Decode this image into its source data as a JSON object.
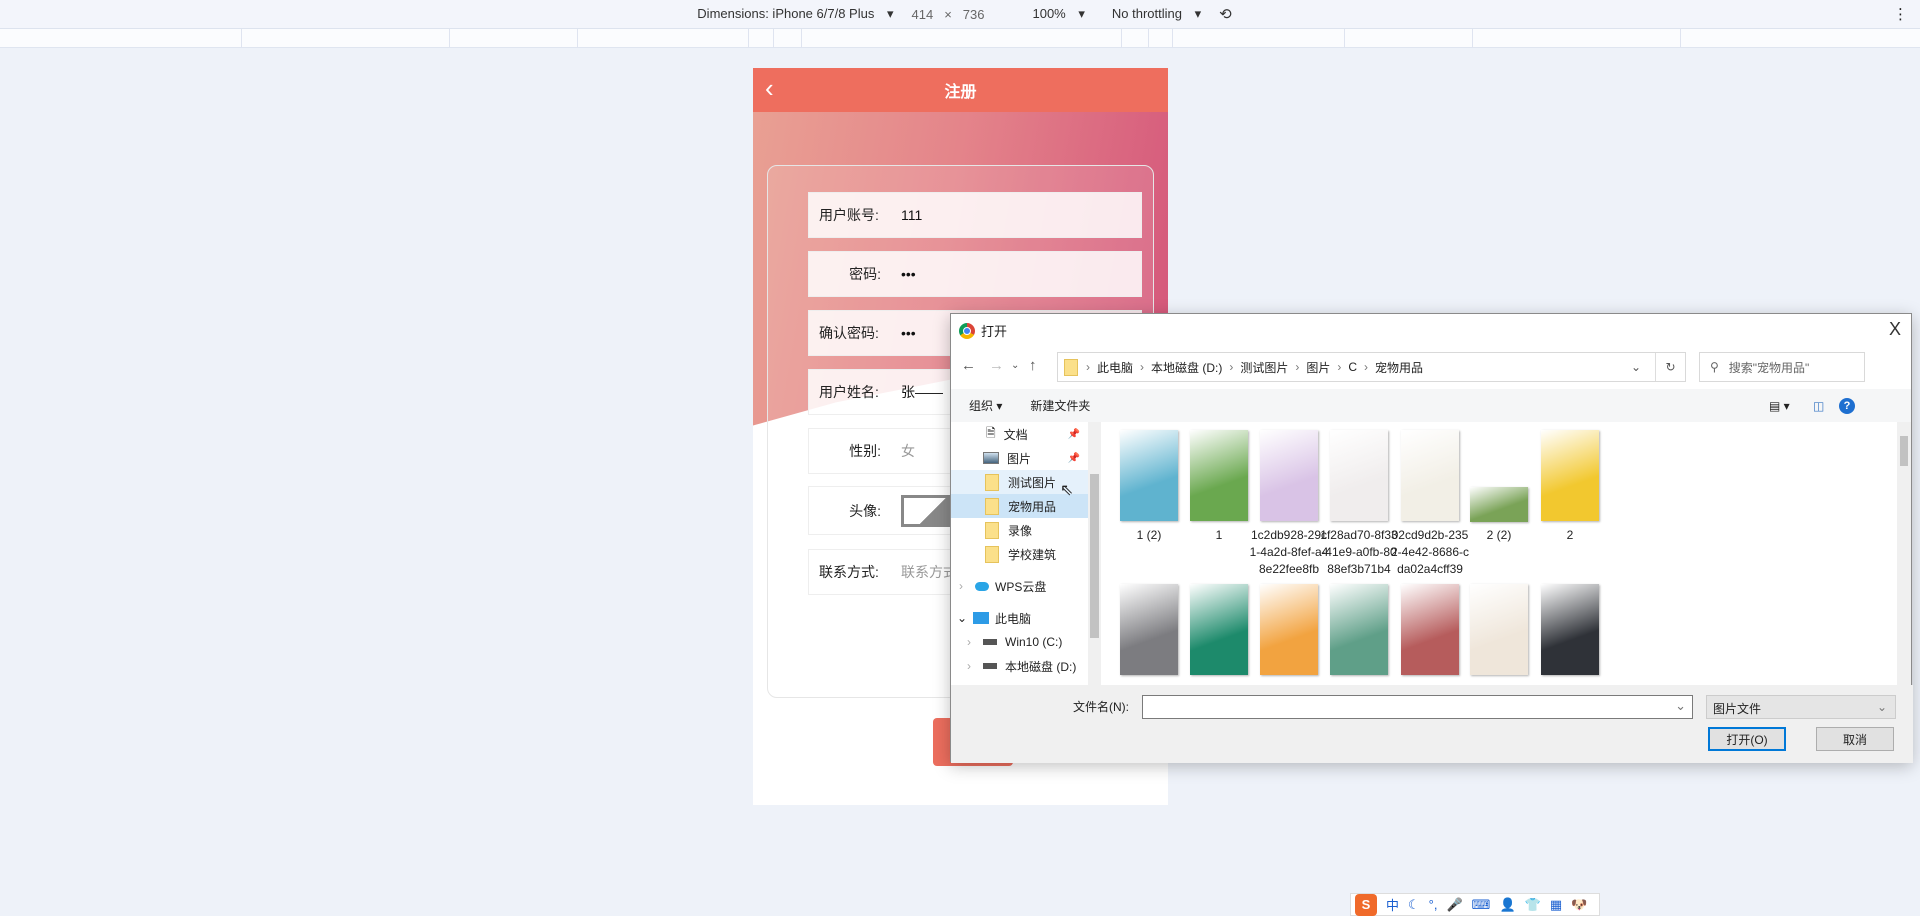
{
  "devtools": {
    "dimensions_label": "Dimensions: iPhone 6/7/8 Plus",
    "width": "414",
    "times": "×",
    "height": "736",
    "zoom": "100%",
    "throttling": "No throttling",
    "menu_icon": "⋮"
  },
  "app": {
    "title": "注册",
    "back_icon": "‹",
    "fields": [
      {
        "label": "用户账号:",
        "value": "111"
      },
      {
        "label": "密码:",
        "value": "•••"
      },
      {
        "label": "确认密码:",
        "value": "•••"
      },
      {
        "label": "用户姓名:",
        "value": "张——"
      },
      {
        "label": "性别:",
        "placeholder": "女"
      },
      {
        "label": "头像:"
      },
      {
        "label": "联系方式:",
        "placeholder": "联系方式"
      }
    ]
  },
  "dialog": {
    "title": "打开",
    "close": "X",
    "breadcrumb": [
      "此电脑",
      "本地磁盘 (D:)",
      "测试图片",
      "图片",
      "C",
      "宠物用品"
    ],
    "search_placeholder": "搜索\"宠物用品\"",
    "organize": "组织 ▾",
    "new_folder": "新建文件夹",
    "nav": [
      {
        "label": "文档",
        "icon": "document-icon",
        "pinned": true
      },
      {
        "label": "图片",
        "icon": "pictures-icon",
        "pinned": true
      },
      {
        "label": "测试图片",
        "icon": "folder-icon",
        "state": "hover"
      },
      {
        "label": "宠物用品",
        "icon": "folder-icon",
        "state": "selected"
      },
      {
        "label": "录像",
        "icon": "folder-icon"
      },
      {
        "label": "学校建筑",
        "icon": "folder-icon"
      },
      {
        "label": "WPS云盘",
        "icon": "cloud-icon",
        "expander": "›"
      },
      {
        "label": "此电脑",
        "icon": "pc-icon",
        "expander": "⌄"
      },
      {
        "label": "Win10 (C:)",
        "icon": "drive-icon",
        "expander": "›"
      },
      {
        "label": "本地磁盘 (D:)",
        "icon": "drive-icon",
        "expander": "›"
      }
    ],
    "files": [
      {
        "name": "1 (2)",
        "color": "#5fb3cf"
      },
      {
        "name": "1",
        "color": "#6aa84f"
      },
      {
        "name": "1c2db928-29c1-4a2d-8fef-a48e22fee8fb",
        "color": "#d9c3e6"
      },
      {
        "name": "1f28ad70-8f33-41e9-a0fb-8088ef3b71b4",
        "color": "#f0eded"
      },
      {
        "name": "02cd9d2b-2352-4e42-8686-cda02a4cff39",
        "color": "#f2efe6"
      },
      {
        "name": "2 (2)",
        "color": "#7aa357"
      },
      {
        "name": "2",
        "color": "#f2c82f"
      },
      {
        "name": "",
        "color": "#7c7c80"
      },
      {
        "name": "",
        "color": "#1d8a6b"
      },
      {
        "name": "",
        "color": "#f2a340"
      },
      {
        "name": "",
        "color": "#5f9f88"
      },
      {
        "name": "",
        "color": "#b65c5c"
      },
      {
        "name": "",
        "color": "#efe6da"
      },
      {
        "name": "",
        "color": "#2f3238"
      }
    ],
    "filename_label": "文件名(N):",
    "filename_value": "",
    "filetype": "图片文件",
    "open_btn": "打开(O)",
    "cancel_btn": "取消"
  },
  "tray": {
    "items": [
      "中",
      "☾",
      "°,",
      "🎤",
      "⌨",
      "👤",
      "👕",
      "▦",
      "🐶"
    ]
  }
}
